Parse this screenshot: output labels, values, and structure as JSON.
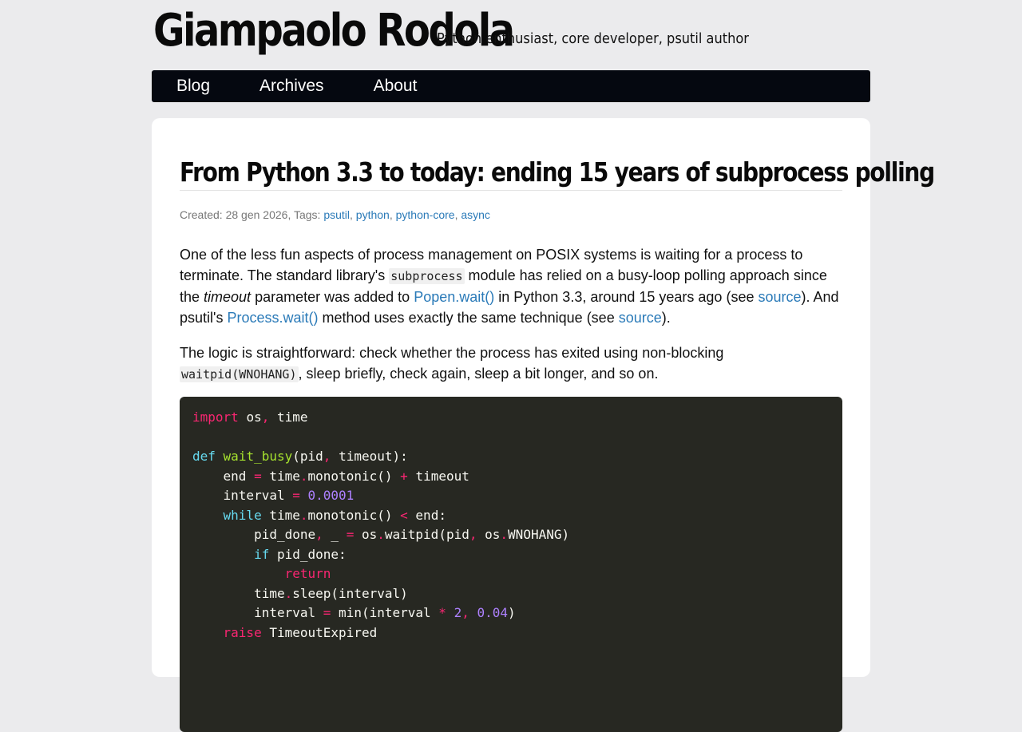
{
  "site": {
    "title": "Giampaolo Rodola",
    "tagline": "Python enthusiast, core developer, psutil author"
  },
  "nav": {
    "items": [
      {
        "label": "Blog"
      },
      {
        "label": "Archives"
      },
      {
        "label": "About"
      }
    ]
  },
  "post": {
    "title": "From Python 3.3 to today: ending 15 years of subprocess polling",
    "meta": {
      "created_label": "Created: 28 gen 2026, Tags:",
      "tags": [
        "psutil",
        "python",
        "python-core",
        "async"
      ]
    },
    "p1": {
      "t1": "One of the less fun aspects of process management on POSIX systems is waiting for a process to terminate. The standard library's ",
      "code1": "subprocess",
      "t2": " module has relied on a busy-loop polling approach since the ",
      "em": "timeout",
      "t3": " parameter was added to ",
      "link1": "Popen.wait()",
      "t4": " in Python 3.3, around 15 years ago (see ",
      "link2": "source",
      "t5": "). And psutil's ",
      "link3": "Process.wait()",
      "t6": " method uses exactly the same technique (see ",
      "link4": "source",
      "t7": ")."
    },
    "p2": {
      "t1": "The logic is straightforward: check whether the process has exited using non-blocking ",
      "code1": "waitpid(WNOHANG)",
      "t2": ", sleep briefly, check again, sleep a bit longer, and so on."
    },
    "code_block": {
      "lines": [
        "import os, time",
        "",
        "def wait_busy(pid, timeout):",
        "    end = time.monotonic() + timeout",
        "    interval = 0.0001",
        "    while time.monotonic() < end:",
        "        pid_done, _ = os.waitpid(pid, os.WNOHANG)",
        "        if pid_done:",
        "            return",
        "        time.sleep(interval)",
        "        interval = min(interval * 2, 0.04)",
        "    raise TimeoutExpired"
      ]
    }
  }
}
